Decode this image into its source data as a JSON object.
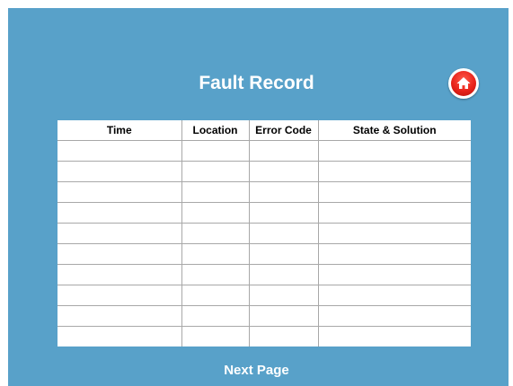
{
  "page": {
    "title": "Fault Record",
    "next_page_label": "Next Page",
    "home_icon": "home-icon",
    "colors": {
      "background": "#58a1c9",
      "table": "#ffffff",
      "home_button": "#e8231a"
    }
  },
  "table": {
    "headers": [
      "Time",
      "Location",
      "Error Code",
      "State & Solution"
    ],
    "rows": [
      [
        "",
        "",
        "",
        ""
      ],
      [
        "",
        "",
        "",
        ""
      ],
      [
        "",
        "",
        "",
        ""
      ],
      [
        "",
        "",
        "",
        ""
      ],
      [
        "",
        "",
        "",
        ""
      ],
      [
        "",
        "",
        "",
        ""
      ],
      [
        "",
        "",
        "",
        ""
      ],
      [
        "",
        "",
        "",
        ""
      ],
      [
        "",
        "",
        "",
        ""
      ],
      [
        "",
        "",
        "",
        ""
      ]
    ]
  }
}
